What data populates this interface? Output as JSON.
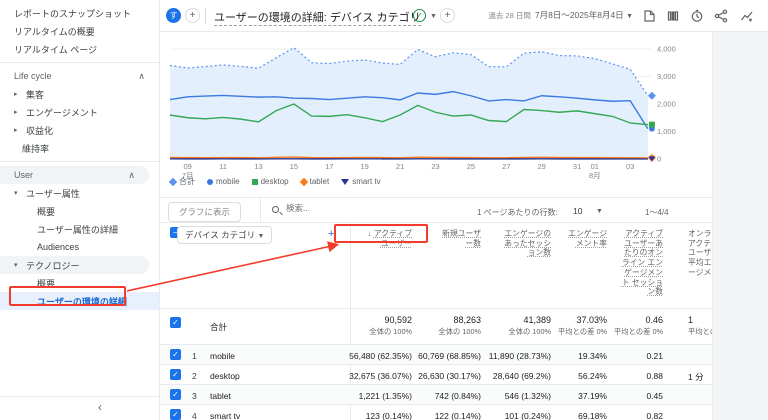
{
  "colors": {
    "annotation_red": "#f43c2c",
    "primary_blue": "#1a73e8",
    "selected_item_bg": "#e8f0fe",
    "area_fill": "#daeafb",
    "series_total": "#5b93f0",
    "series_mobile": "#3d79e0",
    "series_desktop": "#34a853",
    "series_tablet": "#fa7b17",
    "series_smart_tv": "#283593"
  },
  "sidebar": {
    "items": [
      {
        "type": "item",
        "label": "レポートのスナップショット"
      },
      {
        "type": "item",
        "label": "リアルタイムの概要"
      },
      {
        "type": "item",
        "label": "リアルタイム ページ"
      },
      {
        "type": "divider"
      },
      {
        "type": "section",
        "label": "Life cycle"
      },
      {
        "type": "parent",
        "label": "集客",
        "caret": "collapsed"
      },
      {
        "type": "parent",
        "label": "エンゲージメント",
        "caret": "collapsed"
      },
      {
        "type": "parent",
        "label": "収益化",
        "caret": "collapsed"
      },
      {
        "type": "leaf",
        "label": "維持率"
      },
      {
        "type": "divider"
      },
      {
        "type": "section",
        "label": "User",
        "highlight": true
      },
      {
        "type": "parent",
        "label": "ユーザー属性",
        "caret": "expanded"
      },
      {
        "type": "child",
        "label": "概要"
      },
      {
        "type": "child",
        "label": "ユーザー属性の詳細"
      },
      {
        "type": "child",
        "label": "Audiences"
      },
      {
        "type": "parent",
        "label": "テクノロジー",
        "caret": "expanded",
        "highlight": true
      },
      {
        "type": "child",
        "label": "概要"
      },
      {
        "type": "child",
        "label": "ユーザーの環境の詳細",
        "selected": true
      }
    ],
    "collapse_control": "‹"
  },
  "topbar": {
    "comparison_chip": "す",
    "add_comparison": "+",
    "title": "ユーザーの環境の詳細: デバイス カテゴリ",
    "add_button": "+",
    "date_label": "過去 28 日間",
    "date_range": "7月8日～2025年8月4日",
    "icons": [
      "notes-icon",
      "comparison-icon",
      "clock-icon",
      "share-icon",
      "insights-icon"
    ]
  },
  "chart_data": {
    "type": "area",
    "title": "",
    "xlabel": "",
    "ylabel": "",
    "ylim": [
      0,
      4000
    ],
    "y_ticks": [
      "0",
      "1,000",
      "2,000",
      "3,000",
      "4,000"
    ],
    "x_ticks": [
      {
        "label": "09",
        "index": 1,
        "month": "7月"
      },
      {
        "label": "11",
        "index": 3
      },
      {
        "label": "13",
        "index": 5
      },
      {
        "label": "15",
        "index": 7
      },
      {
        "label": "17",
        "index": 9
      },
      {
        "label": "19",
        "index": 11
      },
      {
        "label": "21",
        "index": 13
      },
      {
        "label": "23",
        "index": 15
      },
      {
        "label": "25",
        "index": 17
      },
      {
        "label": "27",
        "index": 19
      },
      {
        "label": "29",
        "index": 21
      },
      {
        "label": "31",
        "index": 23
      },
      {
        "label": "01",
        "index": 24,
        "month": "8月"
      },
      {
        "label": "03",
        "index": 26
      }
    ],
    "legend_position": "bottom",
    "series": [
      {
        "name": "合計",
        "marker": "diamond",
        "style": "dotted",
        "color": "#5b93f0",
        "fill": true,
        "values": [
          3400,
          3310,
          3360,
          3420,
          3370,
          3300,
          3680,
          4050,
          3500,
          3470,
          3560,
          3600,
          3490,
          3440,
          3980,
          3720,
          3860,
          3800,
          3360,
          3350,
          3850,
          3900,
          3760,
          3750,
          3650,
          3460,
          3260,
          2300
        ]
      },
      {
        "name": "mobile",
        "marker": "circle",
        "style": "solid",
        "color": "#3d79e0",
        "values": [
          2160,
          2260,
          2290,
          2310,
          2280,
          2250,
          2260,
          2210,
          2200,
          2160,
          2210,
          2260,
          2230,
          2150,
          2400,
          2350,
          2450,
          2300,
          2110,
          2160,
          2110,
          2300,
          2260,
          2210,
          2150,
          2100,
          2120,
          1100
        ]
      },
      {
        "name": "desktop",
        "marker": "square",
        "style": "solid",
        "color": "#34a853",
        "values": [
          1600,
          1500,
          1460,
          1510,
          1450,
          1350,
          1760,
          2000,
          1560,
          1550,
          1610,
          1500,
          1360,
          1600,
          1950,
          1700,
          1560,
          1600,
          1400,
          1360,
          1800,
          1760,
          1700,
          1750,
          1650,
          1550,
          1310,
          1250
        ]
      },
      {
        "name": "tablet",
        "marker": "diamond",
        "style": "solid",
        "color": "#fa7b17",
        "values": [
          55,
          50,
          48,
          52,
          50,
          45,
          60,
          70,
          50,
          48,
          52,
          55,
          50,
          45,
          65,
          58,
          55,
          52,
          45,
          44,
          58,
          60,
          55,
          54,
          50,
          46,
          42,
          40
        ]
      },
      {
        "name": "smart tv",
        "marker": "triangle-down",
        "style": "solid",
        "color": "#283593",
        "values": [
          6,
          5,
          5,
          6,
          5,
          4,
          6,
          7,
          5,
          5,
          6,
          6,
          5,
          4,
          6,
          6,
          5,
          5,
          4,
          4,
          5,
          6,
          5,
          5,
          5,
          4,
          4,
          4
        ]
      }
    ]
  },
  "toolbar": {
    "chart_button_label": "グラフに表示",
    "search_placeholder": "検索...",
    "rows_per_page_label": "1 ページあたりの行数:",
    "rows_per_page_value": "10",
    "pagination_range": "1～4/4"
  },
  "table": {
    "dimension_label": "デバイス カテゴリ",
    "add_metric": "+",
    "sort_icon": "↓",
    "columns": [
      {
        "label": "アクティブ ユーザー",
        "sorted": true
      },
      {
        "label": "新規ユーザー数"
      },
      {
        "label": "エンゲージのあったセッション数"
      },
      {
        "label": "エンゲージメント率"
      },
      {
        "label": "アクティブ ユーザーあたりのオンライン エンゲージメント セッション数"
      },
      {
        "label": "オンラ\nアクテ\nユーザ\n平均エ\nージメ",
        "truncated": true
      }
    ],
    "totals": {
      "label": "合計",
      "values": [
        "90,592",
        "88,263",
        "41,389",
        "37.03%",
        "0.46",
        "1"
      ],
      "subs": [
        "全体の 100%",
        "全体の 100%",
        "全体の 100%",
        "平均との差 0%",
        "平均との差 0%",
        "平均との"
      ]
    },
    "rows": [
      {
        "num": "1",
        "label": "mobile",
        "values": [
          "56,480 (62.35%)",
          "60,769 (68.85%)",
          "11,890 (28.73%)",
          "19.34%",
          "0.21",
          ""
        ]
      },
      {
        "num": "2",
        "label": "desktop",
        "values": [
          "32,675 (36.07%)",
          "26,630 (30.17%)",
          "28,640 (69.2%)",
          "56.24%",
          "0.88",
          "1 分"
        ]
      },
      {
        "num": "3",
        "label": "tablet",
        "values": [
          "1,221 (1.35%)",
          "742 (0.84%)",
          "546 (1.32%)",
          "37.19%",
          "0.45",
          ""
        ]
      },
      {
        "num": "4",
        "label": "smart tv",
        "values": [
          "123 (0.14%)",
          "122 (0.14%)",
          "101 (0.24%)",
          "69.18%",
          "0.82",
          ""
        ]
      }
    ]
  }
}
